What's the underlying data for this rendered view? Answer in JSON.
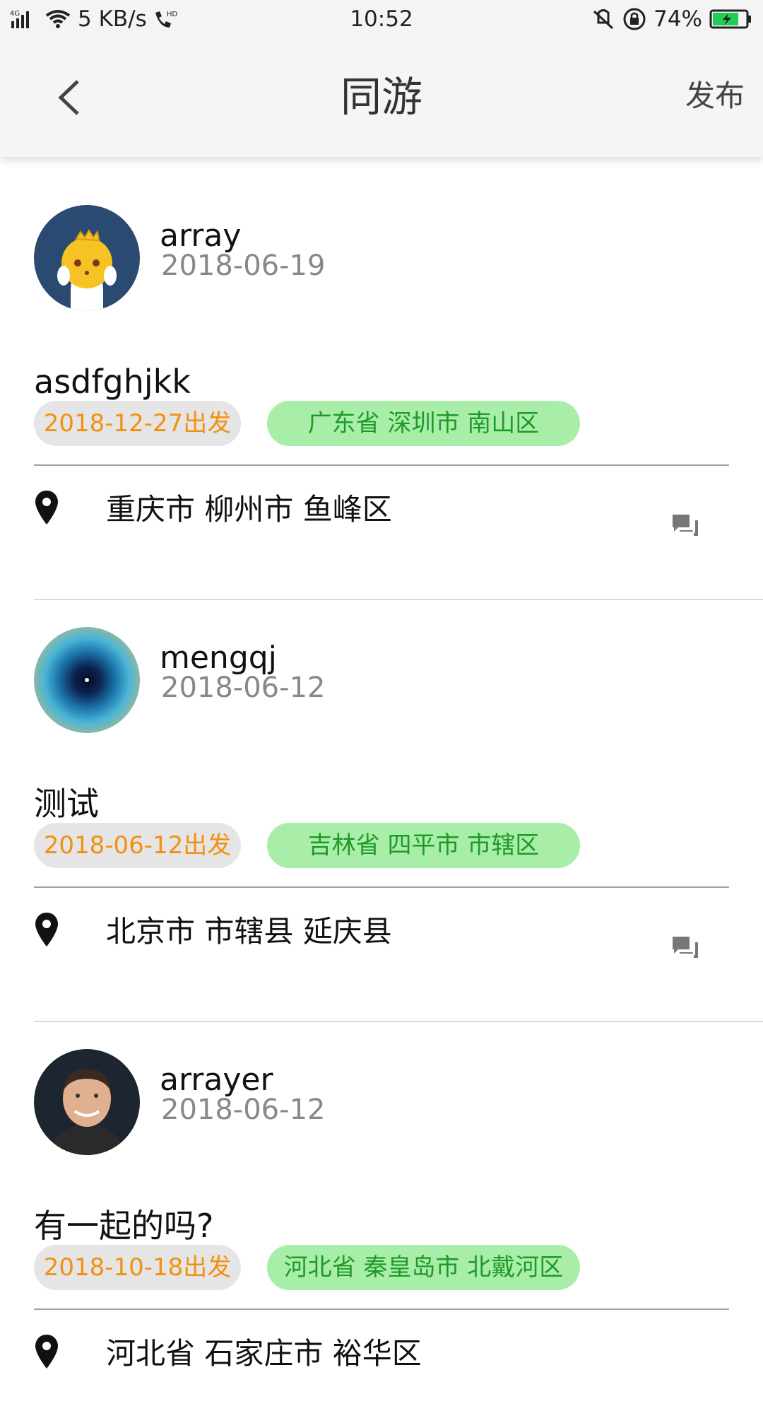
{
  "status_bar": {
    "network": "4G",
    "speed": "5 KB/s",
    "hd": "HD",
    "time": "10:52",
    "battery": "74%"
  },
  "header": {
    "title": "同游",
    "publish_label": "发布"
  },
  "posts": [
    {
      "username": "array",
      "date": "2018-06-19",
      "content": "asdfghjkk",
      "depart": "2018-12-27出发",
      "destination": "广东省 深圳市 南山区",
      "origin": "重庆市 柳州市 鱼峰区"
    },
    {
      "username": "mengqj",
      "date": "2018-06-12",
      "content": "测试",
      "depart": "2018-06-12出发",
      "destination": "吉林省 四平市 市辖区",
      "origin": "北京市 市辖县 延庆县"
    },
    {
      "username": "arrayer",
      "date": "2018-06-12",
      "content": "有一起的吗?",
      "depart": "2018-10-18出发",
      "destination": "河北省 秦皇岛市 北戴河区",
      "origin": "河北省 石家庄市 裕华区"
    }
  ],
  "colors": {
    "date_tag_text": "#f39012",
    "date_tag_bg": "#e5e5e5",
    "place_tag_text": "#1f9a2a",
    "place_tag_bg": "#a8eda8"
  },
  "icons": {
    "back": "chevron-left-icon",
    "location": "map-pin-icon",
    "comment": "chat-bubble-icon"
  }
}
